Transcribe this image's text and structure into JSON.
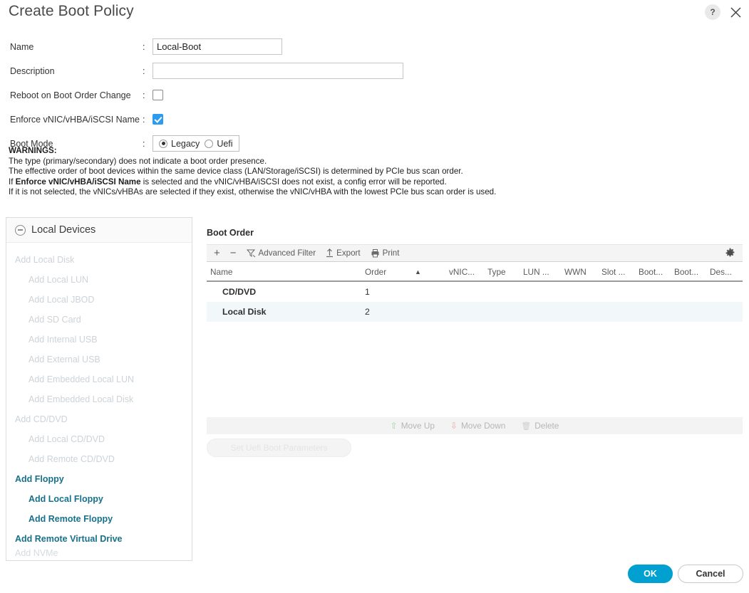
{
  "dialog": {
    "title": "Create Boot Policy",
    "help_icon": "?",
    "close_icon": "close-icon"
  },
  "form": {
    "colon": ":",
    "name": {
      "label": "Name",
      "value": "Local-Boot",
      "placeholder": ""
    },
    "description": {
      "label": "Description",
      "value": "",
      "placeholder": ""
    },
    "reboot_on_change": {
      "label": "Reboot on Boot Order Change",
      "checked": false
    },
    "enforce_name": {
      "label": "Enforce vNIC/vHBA/iSCSI Name",
      "checked": true
    },
    "boot_mode": {
      "label": "Boot Mode",
      "options": [
        "Legacy",
        "Uefi"
      ],
      "selected": "Legacy"
    }
  },
  "warnings": {
    "heading": "WARNINGS:",
    "line1": "The type (primary/secondary) does not indicate a boot order presence.",
    "line2": "The effective order of boot devices within the same device class (LAN/Storage/iSCSI) is determined by PCIe bus scan order.",
    "line3_pre": "If ",
    "line3_bold": "Enforce vNIC/vHBA/iSCSI Name",
    "line3_post": " is selected and the vNIC/vHBA/iSCSI does not exist, a config error will be reported.",
    "line4": "If it is not selected, the vNICs/vHBAs are selected if they exist, otherwise the vNIC/vHBA with the lowest PCIe bus scan order is used."
  },
  "local_devices": {
    "title": "Local Devices",
    "collapse_icon": "circle-minus-icon",
    "items": [
      {
        "label": "Add Local Disk",
        "level": 1,
        "enabled": false
      },
      {
        "label": "Add Local LUN",
        "level": 2,
        "enabled": false
      },
      {
        "label": "Add Local JBOD",
        "level": 2,
        "enabled": false
      },
      {
        "label": "Add SD Card",
        "level": 2,
        "enabled": false
      },
      {
        "label": "Add Internal USB",
        "level": 2,
        "enabled": false
      },
      {
        "label": "Add External USB",
        "level": 2,
        "enabled": false
      },
      {
        "label": "Add Embedded Local LUN",
        "level": 2,
        "enabled": false
      },
      {
        "label": "Add Embedded Local Disk",
        "level": 2,
        "enabled": false
      },
      {
        "label": "Add CD/DVD",
        "level": 1,
        "enabled": false
      },
      {
        "label": "Add Local CD/DVD",
        "level": 2,
        "enabled": false
      },
      {
        "label": "Add Remote CD/DVD",
        "level": 2,
        "enabled": false
      },
      {
        "label": "Add Floppy",
        "level": 1,
        "enabled": true
      },
      {
        "label": "Add Local Floppy",
        "level": 2,
        "enabled": true
      },
      {
        "label": "Add Remote Floppy",
        "level": 2,
        "enabled": true
      },
      {
        "label": "Add Remote Virtual Drive",
        "level": 1,
        "enabled": true
      },
      {
        "label": "Add NVMe",
        "level": 1,
        "enabled": false
      }
    ]
  },
  "boot_order": {
    "title": "Boot Order",
    "toolbar": {
      "add_icon": "+",
      "remove_icon": "−",
      "advanced_filter": "Advanced Filter",
      "export": "Export",
      "print": "Print",
      "settings_icon": "gear-icon"
    },
    "columns": [
      "Name",
      "Order",
      "",
      "vNIC...",
      "Type",
      "LUN ...",
      "WWN",
      "Slot ...",
      "Boot...",
      "Boot...",
      "Des..."
    ],
    "sort_indicator": "▲",
    "sorted_by": "Order",
    "rows": [
      {
        "name": "CD/DVD",
        "order": "1"
      },
      {
        "name": "Local Disk",
        "order": "2"
      }
    ],
    "actions": {
      "move_up": "Move Up",
      "move_down": "Move Down",
      "delete": "Delete",
      "enabled": false
    },
    "uefi_button": {
      "label": "Set Uefi Boot Parameters",
      "enabled": false
    }
  },
  "footer": {
    "ok": "OK",
    "cancel": "Cancel"
  },
  "colors": {
    "accent": "#00a0d1",
    "link": "#17718a",
    "checkbox_checked": "#2d9cf0",
    "row_alt": "#f2f7fa"
  }
}
